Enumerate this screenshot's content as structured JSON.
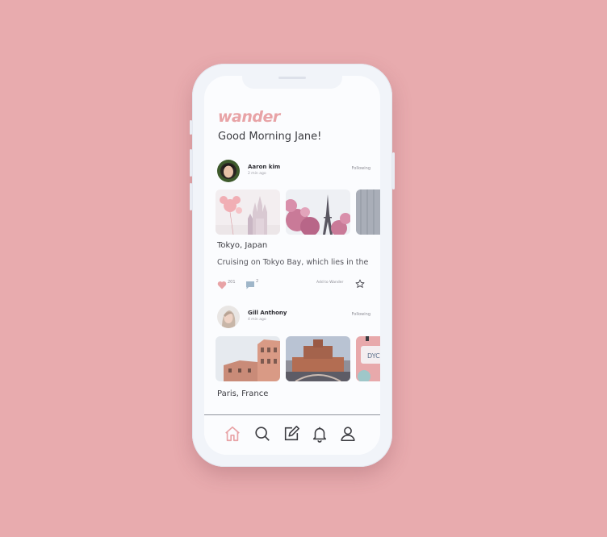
{
  "app": {
    "logo": "wander",
    "greeting": "Good Morning Jane!"
  },
  "posts": [
    {
      "author": "Aaron kim",
      "time": "2 min ago",
      "follow": "Following",
      "location": "Tokyo, Japan",
      "caption": "Cruising on Tokyo Bay, which lies in the",
      "likes": "201",
      "comments": "2",
      "wander_label": "Add to Wander"
    },
    {
      "author": "Gill Anthony",
      "time": "4 min ago",
      "follow": "Following",
      "location": "Paris, France"
    }
  ],
  "nav": [
    "home-icon",
    "search-icon",
    "edit-icon",
    "bell-icon",
    "user-icon"
  ],
  "colors": {
    "background": "#e8abae",
    "accent": "#e8a3a6",
    "screen": "#fbfcfe"
  }
}
